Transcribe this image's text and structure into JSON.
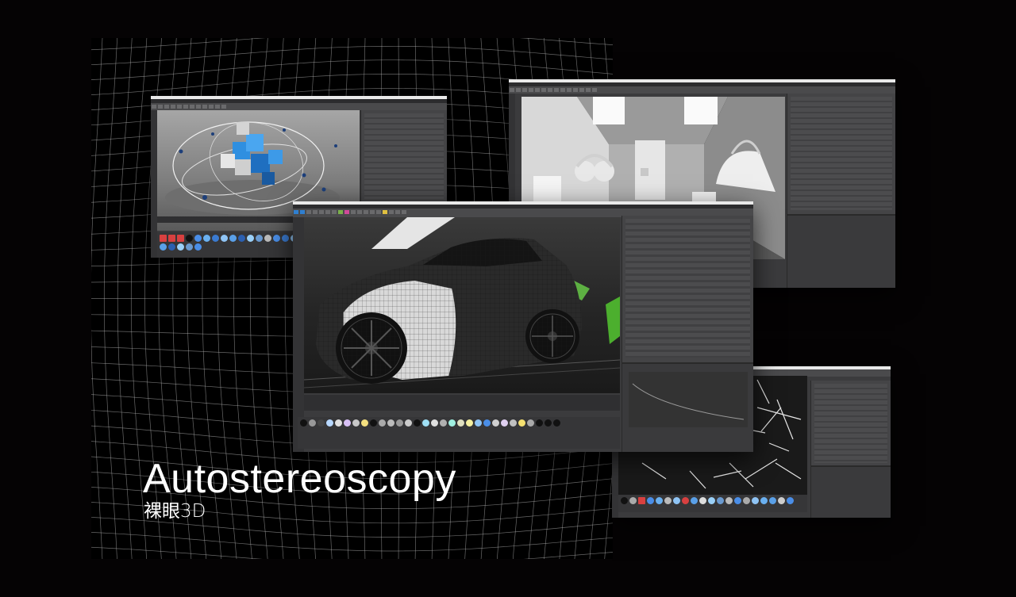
{
  "title": {
    "main": "Autostereoscopy",
    "sub": "裸眼3D"
  },
  "colors": {
    "background": "#050304",
    "grid_line": "#bdbdbd",
    "window_bg": "#3b3b3d",
    "cube_blue": "#2f8fe0",
    "accent_green": "#4caf2e"
  },
  "windows": [
    {
      "name": "viewport-cubes-window",
      "scene": "blue-cubes-with-orbits"
    },
    {
      "name": "viewport-room-window",
      "scene": "white-interior-with-headphones-and-bag"
    },
    {
      "name": "viewport-lines-window",
      "scene": "white-line-sketch"
    },
    {
      "name": "viewport-car-window",
      "scene": "wireframe-car"
    }
  ]
}
